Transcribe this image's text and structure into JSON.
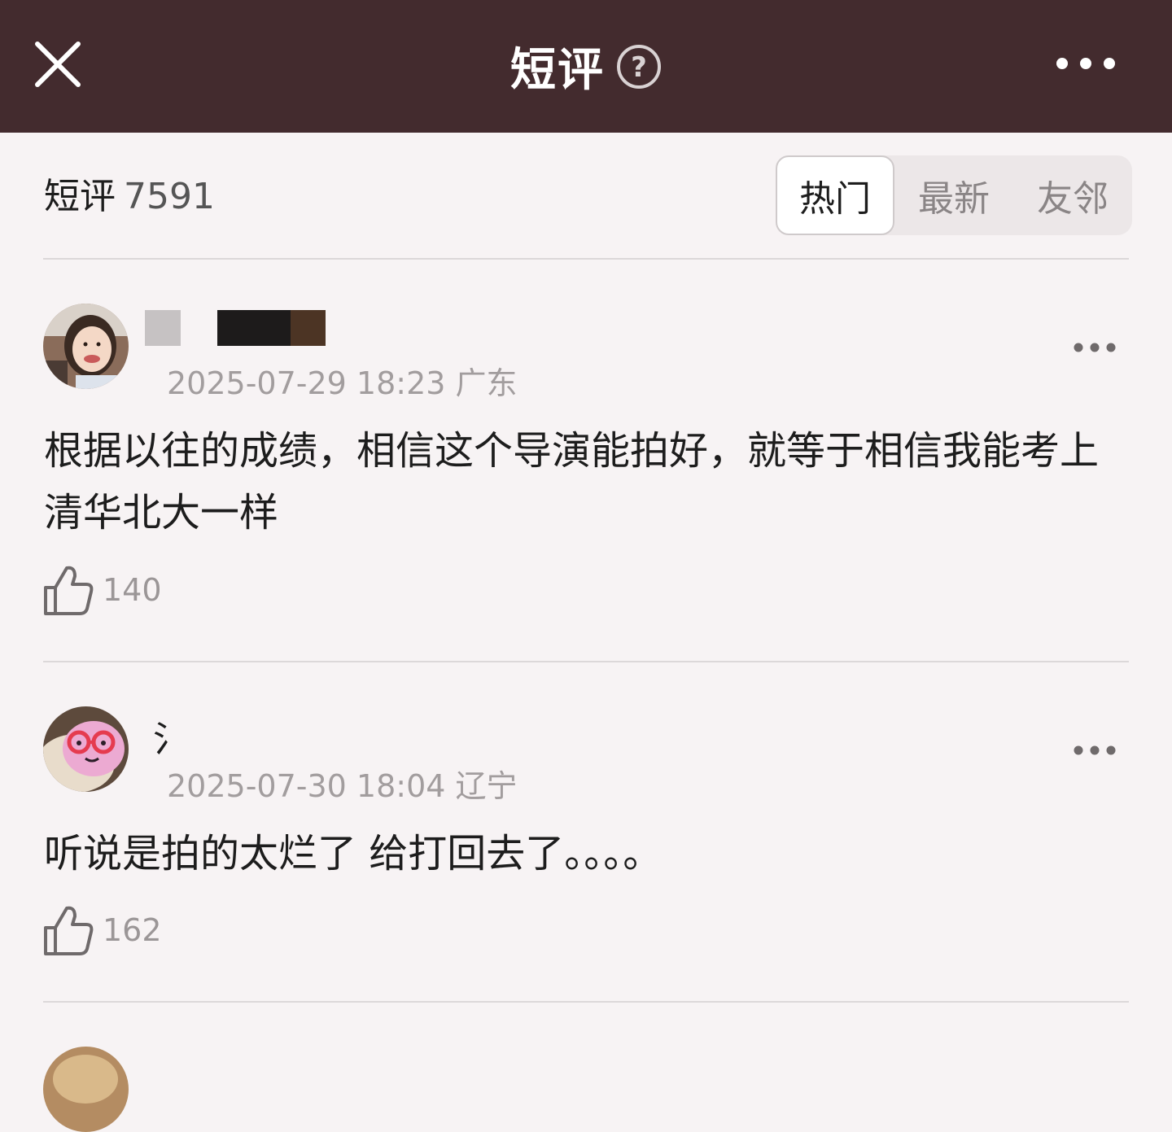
{
  "header": {
    "title": "短评",
    "close_icon": "close-icon",
    "help_icon": "help-icon",
    "more_icon": "more-icon",
    "background": "#432b2e"
  },
  "subheader": {
    "label": "短评",
    "count": "7591",
    "tabs": [
      {
        "label": "热门",
        "active": true
      },
      {
        "label": "最新",
        "active": false
      },
      {
        "label": "友邻",
        "active": false
      }
    ]
  },
  "comments": [
    {
      "time": "2025-07-29 18:23",
      "location": "广东",
      "text": "根据以往的成绩，相信这个导演能拍好，就等于相信我能考上清华北大一样",
      "likes": "140"
    },
    {
      "username_visible": "氵",
      "time": "2025-07-30 18:04",
      "location": "辽宁",
      "text": "听说是拍的太烂了 给打回去了。。。。",
      "likes": "162"
    }
  ]
}
